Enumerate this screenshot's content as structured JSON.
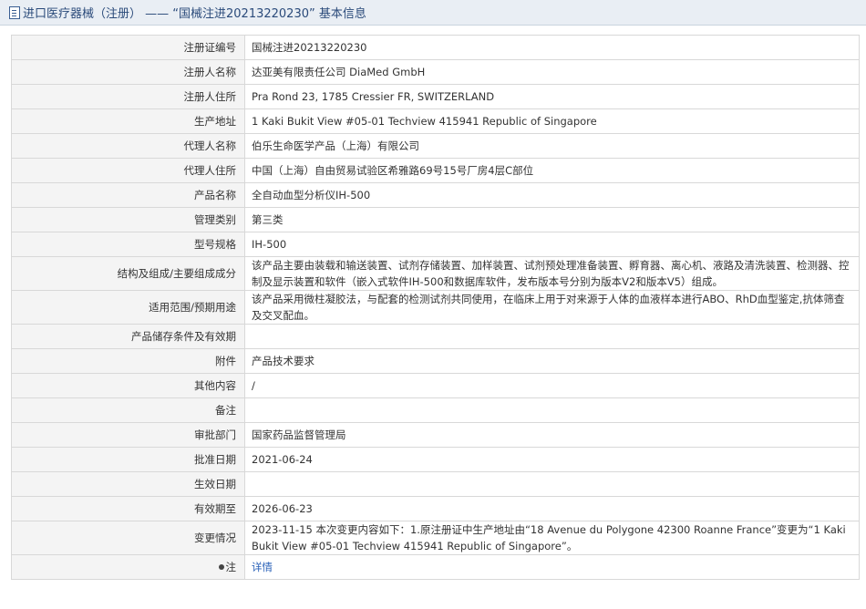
{
  "header": {
    "title": "进口医疗器械（注册） —— “国械注进20213220230” 基本信息"
  },
  "rows": [
    {
      "label": "注册证编号",
      "value": "国械注进20213220230"
    },
    {
      "label": "注册人名称",
      "value": "达亚美有限责任公司 DiaMed GmbH"
    },
    {
      "label": "注册人住所",
      "value": "Pra Rond 23, 1785 Cressier FR, SWITZERLAND"
    },
    {
      "label": "生产地址",
      "value": "1 Kaki Bukit View #05-01 Techview 415941 Republic of Singapore"
    },
    {
      "label": "代理人名称",
      "value": "伯乐生命医学产品（上海）有限公司"
    },
    {
      "label": "代理人住所",
      "value": "中国（上海）自由贸易试验区希雅路69号15号厂房4层C部位"
    },
    {
      "label": "产品名称",
      "value": "全自动血型分析仪IH-500"
    },
    {
      "label": "管理类别",
      "value": "第三类"
    },
    {
      "label": "型号规格",
      "value": "IH-500"
    },
    {
      "label": "结构及组成/主要组成成分",
      "value": "该产品主要由装载和输送装置、试剂存储装置、加样装置、试剂预处理准备装置、孵育器、离心机、液路及清洗装置、检测器、控制及显示装置和软件（嵌入式软件IH-500和数据库软件，发布版本号分别为版本V2和版本V5）组成。"
    },
    {
      "label": "适用范围/预期用途",
      "value": "该产品采用微柱凝胶法，与配套的检测试剂共同使用，在临床上用于对来源于人体的血液样本进行ABO、RhD血型鉴定,抗体筛查及交叉配血。"
    },
    {
      "label": "产品储存条件及有效期",
      "value": ""
    },
    {
      "label": "附件",
      "value": "产品技术要求"
    },
    {
      "label": "其他内容",
      "value": "/"
    },
    {
      "label": "备注",
      "value": ""
    },
    {
      "label": "审批部门",
      "value": "国家药品监督管理局"
    },
    {
      "label": "批准日期",
      "value": "2021-06-24"
    },
    {
      "label": "生效日期",
      "value": ""
    },
    {
      "label": "有效期至",
      "value": "2026-06-23"
    },
    {
      "label": "变更情况",
      "value": "2023-11-15 本次变更内容如下：1.原注册证中生产地址由“18 Avenue du Polygone 42300 Roanne France”变更为“1 Kaki Bukit View #05-01 Techview 415941 Republic of Singapore”。"
    }
  ],
  "note": {
    "label": "注",
    "link_text": "详情"
  }
}
